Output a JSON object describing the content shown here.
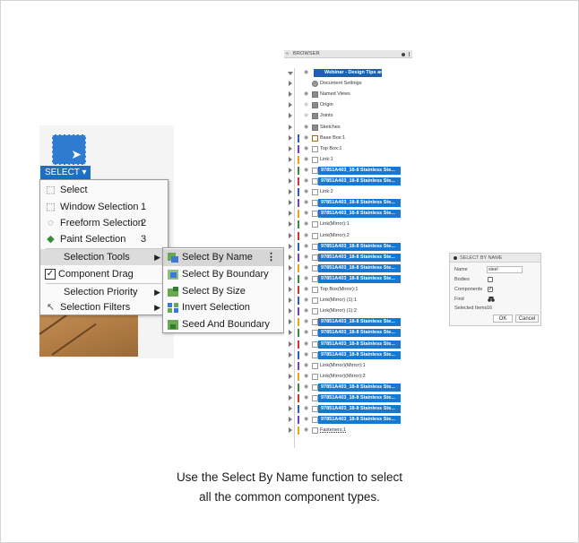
{
  "select_button": {
    "label": "SELECT ▾"
  },
  "select_menu": {
    "items": [
      {
        "label": "Select",
        "shortcut": ""
      },
      {
        "label": "Window Selection",
        "shortcut": "1"
      },
      {
        "label": "Freeform Selection",
        "shortcut": "2"
      },
      {
        "label": "Paint Selection",
        "shortcut": "3"
      },
      {
        "label": "Selection Tools",
        "shortcut": ""
      },
      {
        "label": "Component Drag",
        "shortcut": ""
      },
      {
        "label": "Selection Priority",
        "shortcut": ""
      },
      {
        "label": "Selection Filters",
        "shortcut": ""
      }
    ],
    "component_drag_checked": "✓"
  },
  "selection_tools_submenu": {
    "items": [
      {
        "label": "Select By Name"
      },
      {
        "label": "Select By Boundary"
      },
      {
        "label": "Select By Size"
      },
      {
        "label": "Invert Selection"
      },
      {
        "label": "Seed And Boundary"
      }
    ],
    "kebab": "⋮"
  },
  "browser": {
    "title": "BROWSER",
    "collapse_icon": "«",
    "rows": [
      {
        "label": "Webinar - Design Tips ar...",
        "type": "root"
      },
      {
        "label": "Document Settings",
        "type": "gear"
      },
      {
        "label": "Named Views",
        "type": "folder"
      },
      {
        "label": "Origin",
        "type": "folder-faded"
      },
      {
        "label": "Joints",
        "type": "folder-faded"
      },
      {
        "label": "Sketches",
        "type": "folder"
      },
      {
        "label": "Base Box:1",
        "type": "body"
      },
      {
        "label": "Top Box:1",
        "type": "comp"
      },
      {
        "label": "Link:1",
        "type": "comp"
      },
      {
        "label": "97851A403_18-8 Stainless Ste...",
        "type": "hl"
      },
      {
        "label": "97851A403_18-8 Stainless Ste...",
        "type": "hl"
      },
      {
        "label": "Link:2",
        "type": "comp"
      },
      {
        "label": "97851A403_18-8 Stainless Ste...",
        "type": "hl"
      },
      {
        "label": "97851A403_18-8 Stainless Ste...",
        "type": "hl"
      },
      {
        "label": "Link(Mirror):1",
        "type": "comp"
      },
      {
        "label": "Link(Mirror):2",
        "type": "comp"
      },
      {
        "label": "97851A403_18-8 Stainless Ste...",
        "type": "hl"
      },
      {
        "label": "97851A403_18-8 Stainless Ste...",
        "type": "hl"
      },
      {
        "label": "97851A403_18-8 Stainless Ste...",
        "type": "hl"
      },
      {
        "label": "97851A403_18-8 Stainless Ste...",
        "type": "hl"
      },
      {
        "label": "Top Box(Mirror):1",
        "type": "comp"
      },
      {
        "label": "Link(Mirror) (1):1",
        "type": "comp"
      },
      {
        "label": "Link(Mirror) (1):2",
        "type": "comp"
      },
      {
        "label": "97851A403_18-8 Stainless Ste...",
        "type": "hl"
      },
      {
        "label": "97851A403_18-8 Stainless Ste...",
        "type": "hl"
      },
      {
        "label": "97851A403_18-8 Stainless Ste...",
        "type": "hl"
      },
      {
        "label": "97851A403_18-8 Stainless Ste...",
        "type": "hl"
      },
      {
        "label": "Link(Mirror)(Mirror):1",
        "type": "comp"
      },
      {
        "label": "Link(Mirror)(Mirror):2",
        "type": "comp"
      },
      {
        "label": "97851A403_18-8 Stainless Ste...",
        "type": "hl"
      },
      {
        "label": "97851A403_18-8 Stainless Ste...",
        "type": "hl"
      },
      {
        "label": "97851A403_18-8 Stainless Ste...",
        "type": "hl"
      },
      {
        "label": "97851A403_18-8 Stainless Ste...",
        "type": "hl"
      },
      {
        "label": "Fasteners:1",
        "type": "last"
      }
    ]
  },
  "select_by_name_panel": {
    "title": "SELECT BY NAME",
    "name_label": "Name",
    "name_value": "steel",
    "bodies_label": "Bodies",
    "components_label": "Components",
    "find_label": "Find",
    "find_icon": "binoculars-icon",
    "selected_items_label": "Selected Items",
    "selected_items_value": "16",
    "ok_label": "OK",
    "cancel_label": "Cancel"
  },
  "caption": {
    "line1": "Use the Select By Name function to select",
    "line2": "all the common component types."
  },
  "colors": {
    "accent_blue": "#1478d4",
    "select_tab_blue": "#1a6fc9",
    "menu_highlight": "#dcdcdc"
  }
}
